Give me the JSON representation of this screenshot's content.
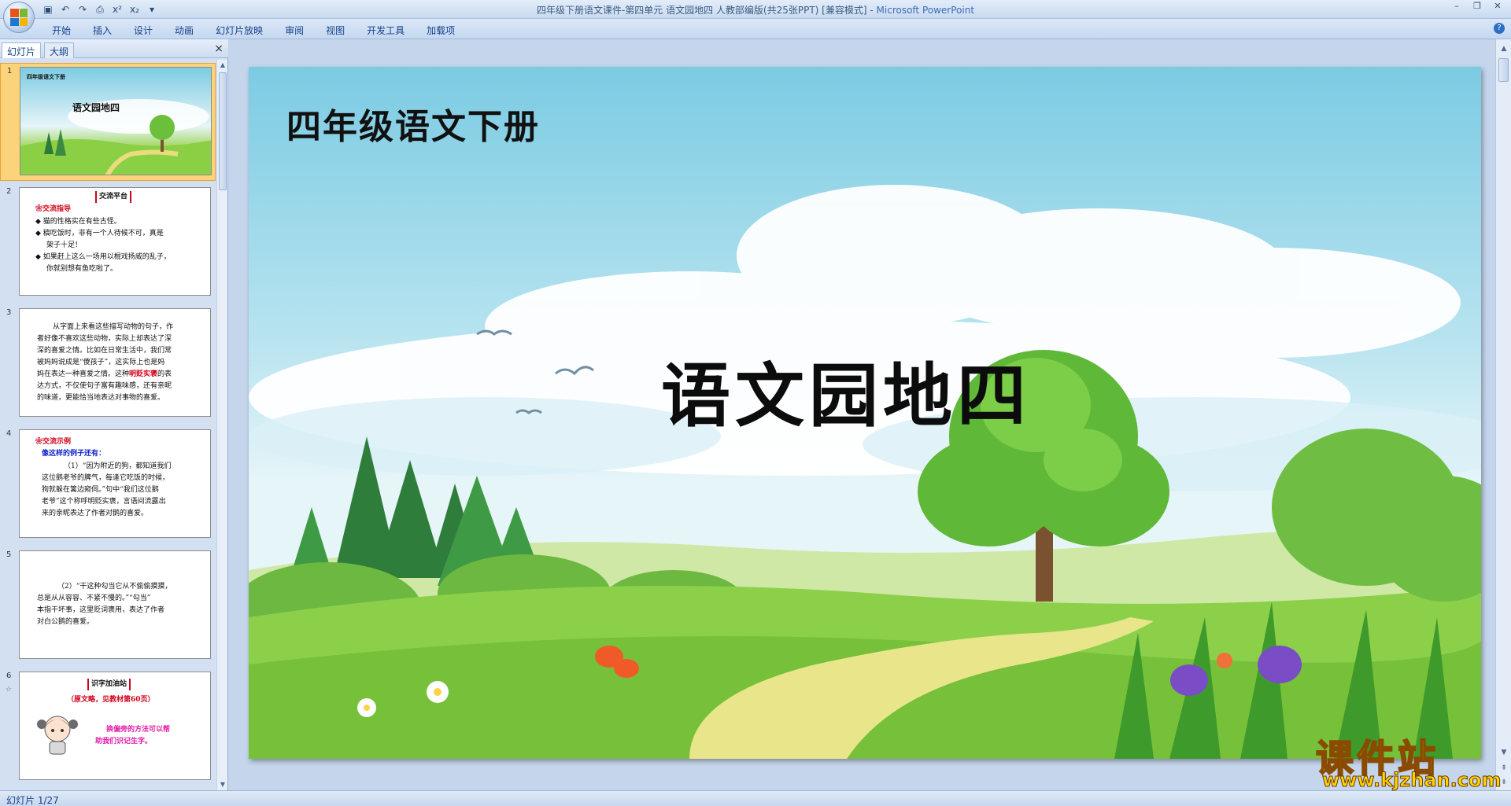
{
  "window": {
    "title": "四年级下册语文课件-第四单元  语文园地四  人教部编版(共25张PPT) [兼容模式]",
    "app_name": "Microsoft PowerPoint"
  },
  "qat": [
    "save-icon",
    "undo-icon",
    "redo-icon",
    "print-preview-icon",
    "superscript-icon",
    "subscript-icon",
    "customize-icon"
  ],
  "ribbon": {
    "tabs": [
      "开始",
      "插入",
      "设计",
      "动画",
      "幻灯片放映",
      "审阅",
      "视图",
      "开发工具",
      "加载项"
    ]
  },
  "panel": {
    "tab_slides": "幻灯片",
    "tab_outline": "大纲",
    "close": "×"
  },
  "thumbs": {
    "s1": {
      "num": "1",
      "top": "四年级语文下册",
      "title": "语文园地四"
    },
    "s2": {
      "num": "2",
      "header": "交流平台",
      "sub": "❀交流指导",
      "lines": [
        "◆ 猫的性格实在有些古怪。",
        "◆ 稿吃饭时，非有一个人待候不可，真是",
        "架子十足！",
        "◆ 如果赶上这么一场用以棍戏扬威的乱子，",
        "你就别想有鱼吃啦了。"
      ]
    },
    "s3": {
      "num": "3",
      "lines": [
        "从字面上来看这些描写动物的句子，作",
        "者好像不喜欢这些动物，实际上却表达了深",
        "深的喜爱之情。比如在日常生活中，我们常",
        "被妈妈说成是“傻孩子”，这实际上也是妈",
        "妈在表达一种喜爱之情。这种",
        "明贬实褒",
        "的表",
        "达方式，不仅使句子富有趣味感，还有亲昵",
        "的味道，更能恰当地表达对事物的喜爱。"
      ]
    },
    "s4": {
      "num": "4",
      "sub": "❀交流示例",
      "blue": "像这样的例子还有：",
      "lines": [
        "（1）“因为附近的狗，都知道我们",
        "这位鹅老爷的脾气，每逢它吃饭的时候，",
        "狗就躲在篱边窥伺。”句中“我们这位鹅",
        "老爷”这个称呼明贬实褒，言语间流露出",
        "来的亲昵表达了作者对鹅的喜爱。"
      ]
    },
    "s5": {
      "num": "5",
      "lines": [
        "（2）“干这种勾当它从不偷偷摸摸，",
        "总是从从容容、不紧不慢的。”“勾当”",
        "本指干坏事，这里贬词褒用，表达了作者",
        "对白公鹅的喜爱。"
      ]
    },
    "s6": {
      "num": "6",
      "header": "识字加油站",
      "red": "（原文略，见教材第60页）",
      "mag": [
        "换偏旁的方法可以帮",
        "助我们识记生字。"
      ]
    }
  },
  "slide": {
    "title_small": "四年级语文下册",
    "title_big": "语文园地四"
  },
  "status": {
    "text": "幻灯片 1/27"
  },
  "watermark": {
    "main": "课件站",
    "url": "www.kjzhan.com"
  },
  "colors": {
    "sky_top": "#7ccbe3",
    "grass": "#7cc43a",
    "selected_thumb": "#fbd37a",
    "accent_red": "#d0021b"
  }
}
